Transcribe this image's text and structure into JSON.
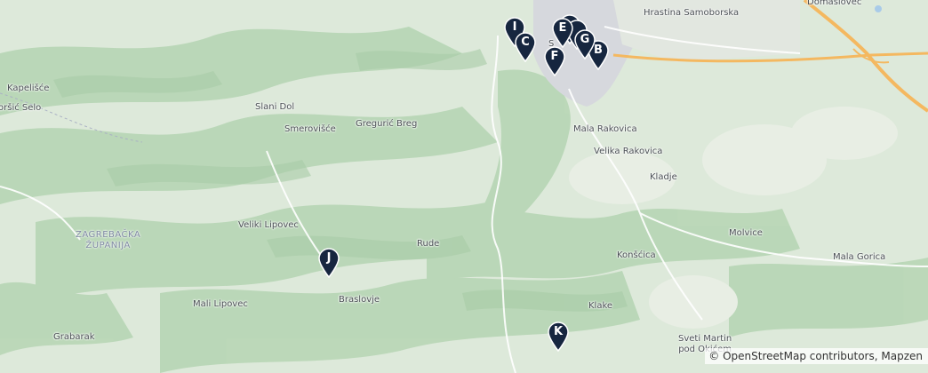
{
  "map": {
    "places": [
      {
        "id": "hrastina",
        "name": "Hrastina Samoborska"
      },
      {
        "id": "domaslovec",
        "name": "Domaslovec"
      },
      {
        "id": "kapelisce",
        "name": "Kapelišće"
      },
      {
        "id": "orsic-selo",
        "name": "oršić Selo"
      },
      {
        "id": "slani-dol",
        "name": "Slani Dol"
      },
      {
        "id": "smerovisce",
        "name": "Smerovišće"
      },
      {
        "id": "greguric-breg",
        "name": "Gregurić Breg"
      },
      {
        "id": "mala-rakovica",
        "name": "Mala Rakovica"
      },
      {
        "id": "velika-rakovica",
        "name": "Velika Rakovica"
      },
      {
        "id": "kladje",
        "name": "Kladje"
      },
      {
        "id": "veliki-lipovec",
        "name": "Veliki Lipovec"
      },
      {
        "id": "rude",
        "name": "Rude"
      },
      {
        "id": "molvice",
        "name": "Molvice"
      },
      {
        "id": "konscica",
        "name": "Konšćica"
      },
      {
        "id": "mala-gorica",
        "name": "Mala Gorica"
      },
      {
        "id": "braslovje",
        "name": "Braslovje"
      },
      {
        "id": "mali-lipovec",
        "name": "Mali Lipovec"
      },
      {
        "id": "klake",
        "name": "Klake"
      },
      {
        "id": "grabarak",
        "name": "Grabarak"
      },
      {
        "id": "samobor-partial",
        "name": "S"
      }
    ],
    "region_label": "ZAGREBAČKA\nŽUPANIJA",
    "sveti_martin": "Sveti Martin\npod Okićem",
    "markers": [
      {
        "id": "I",
        "label": "I"
      },
      {
        "id": "C",
        "label": "C"
      },
      {
        "id": "E",
        "label": "E"
      },
      {
        "id": "F",
        "label": "F"
      },
      {
        "id": "G",
        "label": "G"
      },
      {
        "id": "B",
        "label": "B"
      },
      {
        "id": "J",
        "label": "J"
      },
      {
        "id": "K",
        "label": "K"
      }
    ],
    "attribution": {
      "prefix": "© ",
      "osm": "OpenStreetMap contributors",
      "sep": ", ",
      "mapzen": "Mapzen"
    },
    "colors": {
      "forest": "#b9d7b7",
      "land": "#dde9da",
      "urban": "#d6d8dd",
      "highway": "#f4b860",
      "marker": "#16263f"
    }
  }
}
